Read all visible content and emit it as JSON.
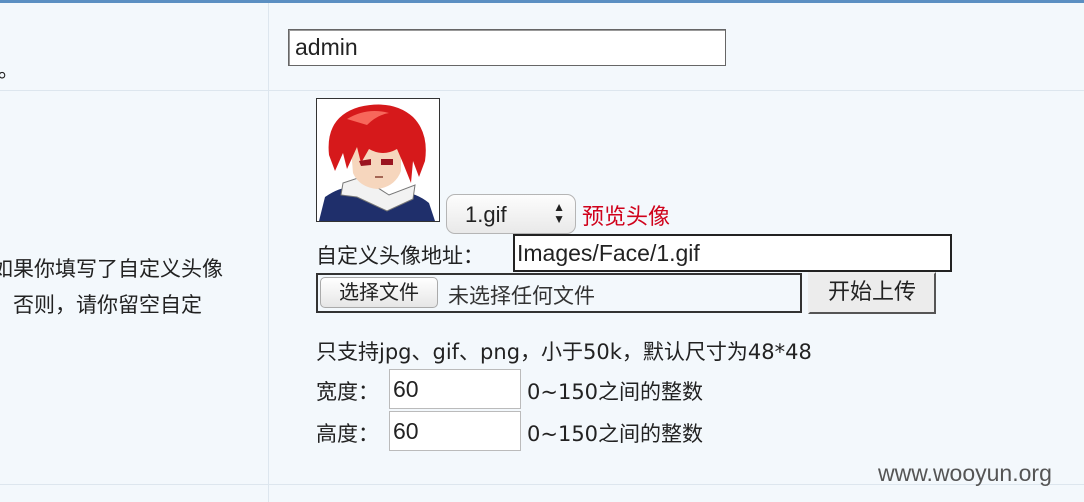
{
  "row1": {
    "left_text": "。",
    "username_value": "admin"
  },
  "row2": {
    "left_text_line1": "如果你填写了自定义头像",
    "left_text_line2": "。否则，请你留空自定",
    "avatar_select": {
      "selected": "1.gif"
    },
    "preview_label": "预览头像",
    "custom_url_label": "自定义头像地址：",
    "custom_url_value": "Images/Face/1.gif",
    "file_button_label": "选择文件",
    "file_status": "未选择任何文件",
    "upload_button_label": "开始上传",
    "support_note": "只支持jpg、gif、png，小于50k，默认尺寸为48*48",
    "width_label": "宽度：",
    "width_value": "60",
    "width_hint": "0~150之间的整数",
    "height_label": "高度：",
    "height_value": "60",
    "height_hint": "0~150之间的整数"
  },
  "watermark": "www.wooyun.org",
  "colors": {
    "accent_rule": "#5b8fc2",
    "background": "#f3f8fc",
    "preview_red": "#d0021b"
  }
}
